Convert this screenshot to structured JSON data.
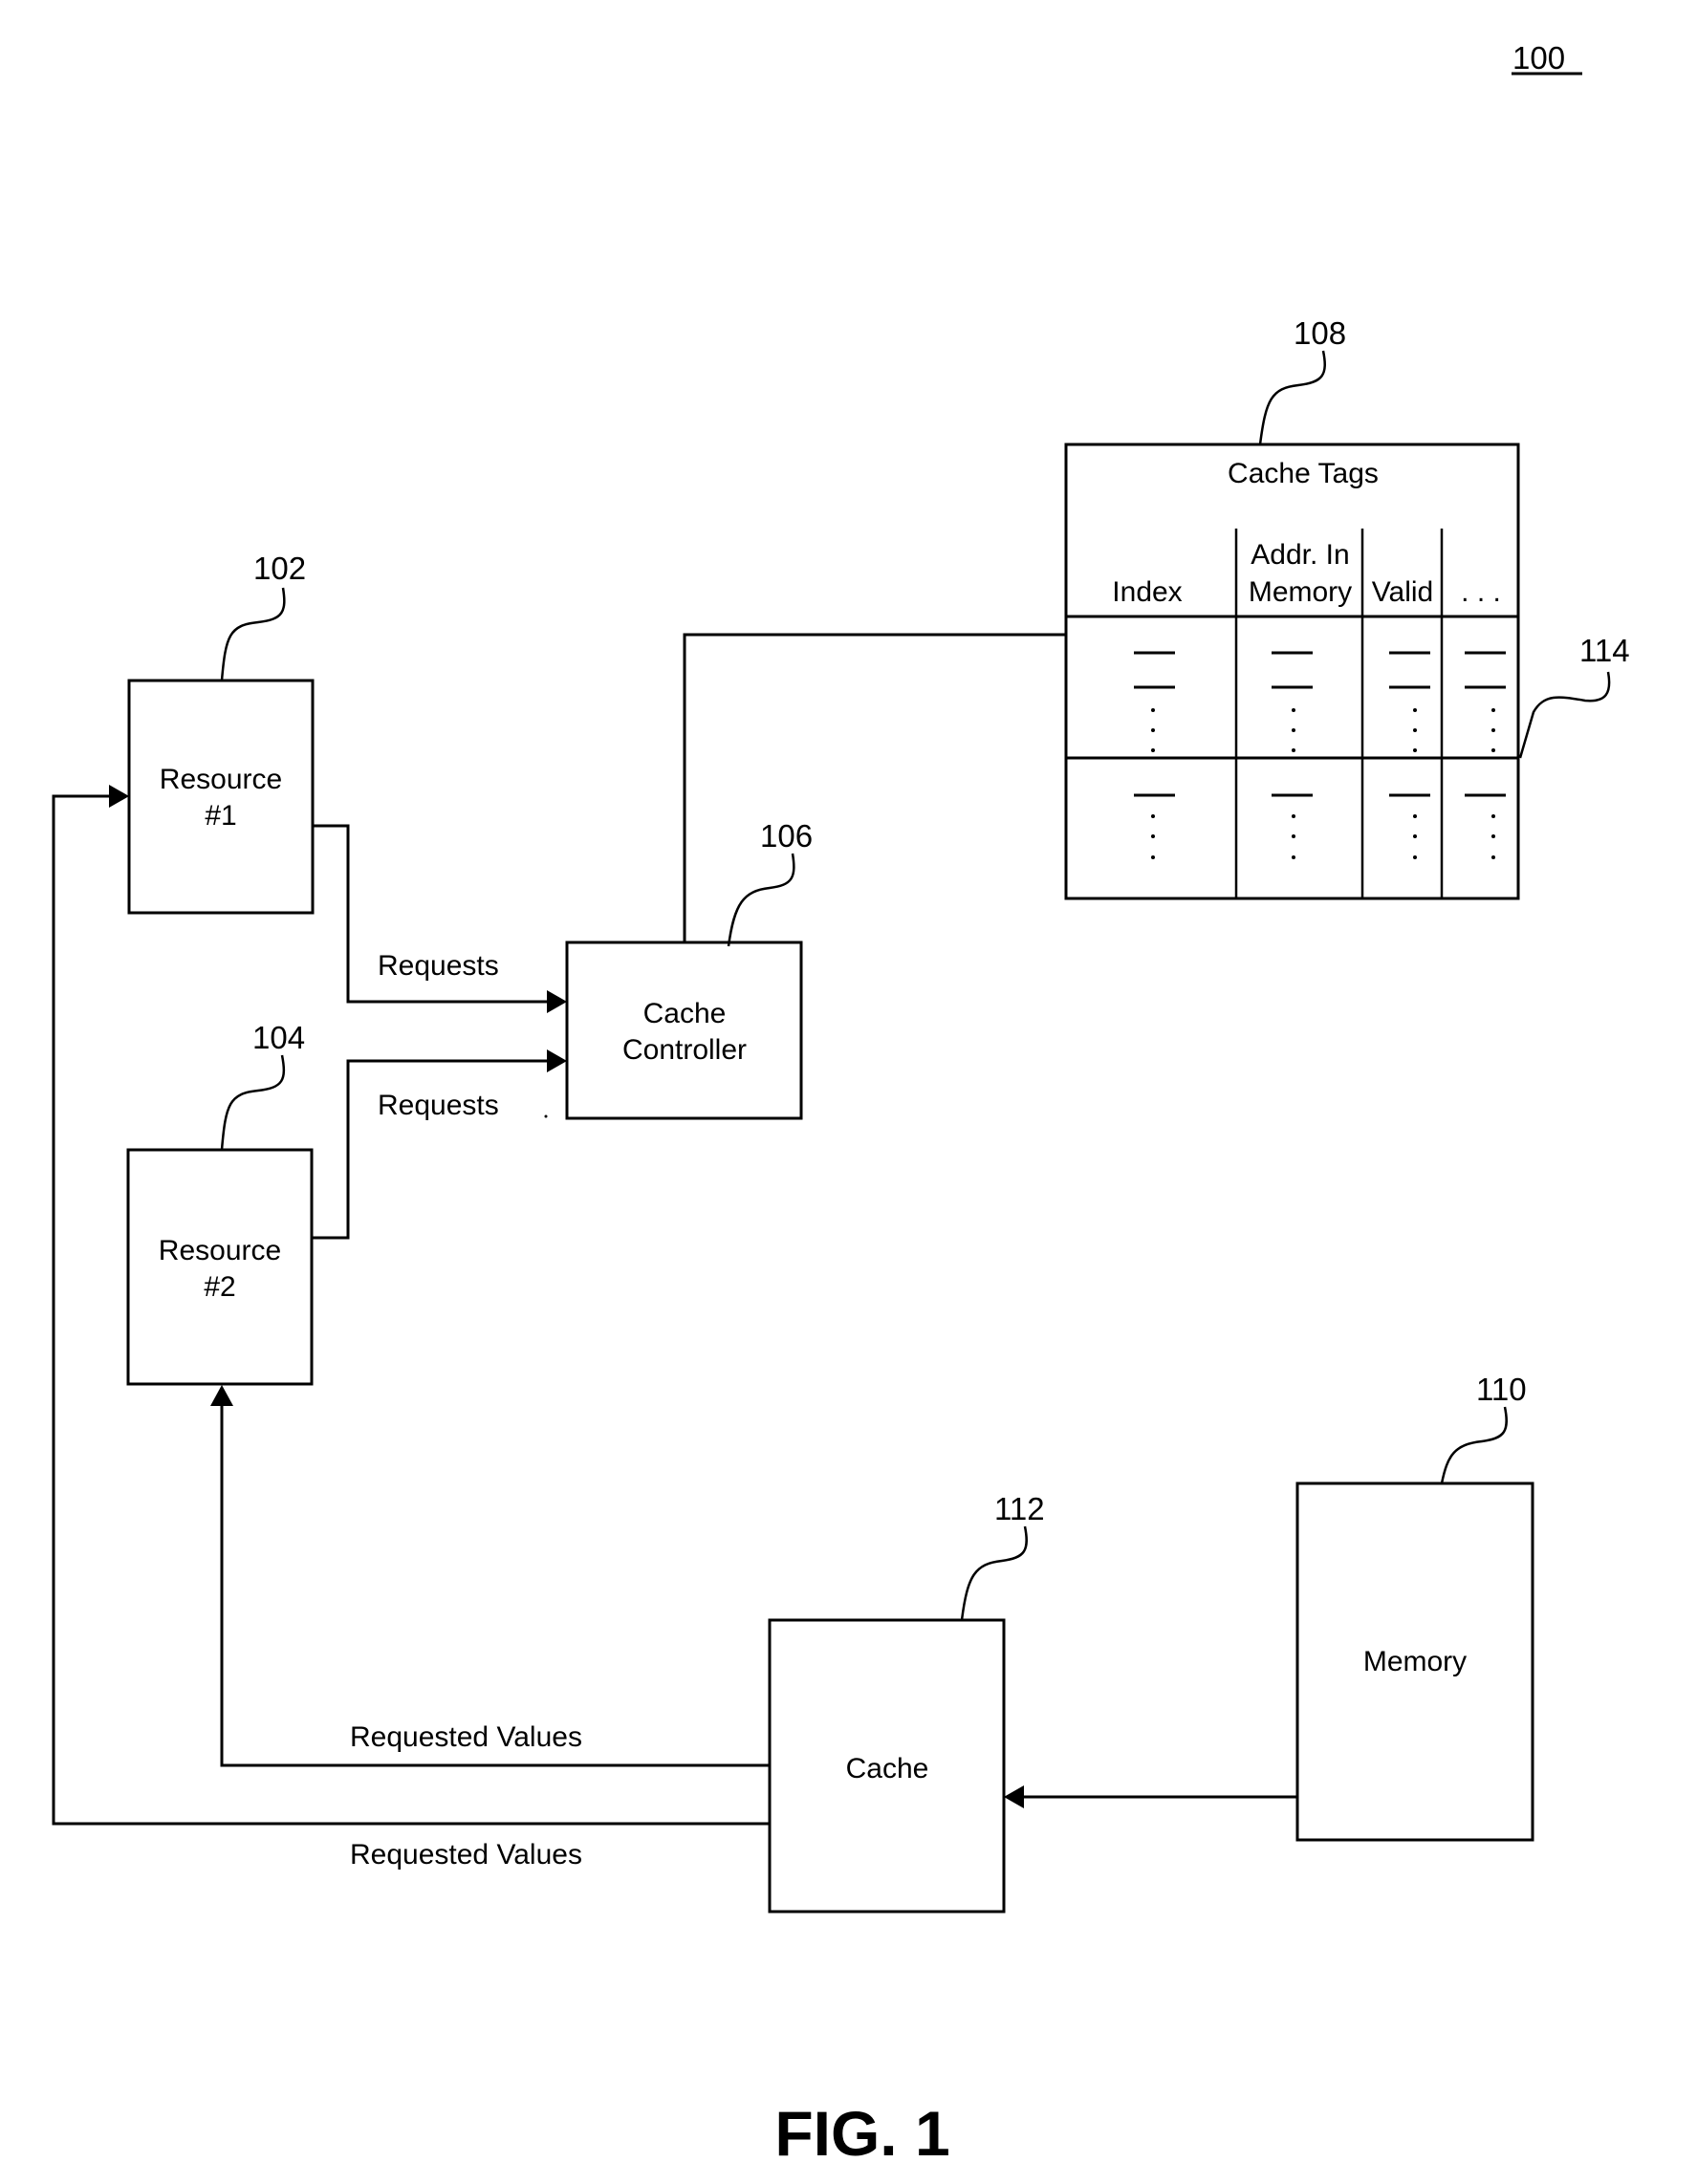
{
  "figure": {
    "reference": "100",
    "caption": "FIG. 1"
  },
  "components": {
    "resource1": {
      "ref": "102",
      "line1": "Resource",
      "line2": "#1"
    },
    "resource2": {
      "ref": "104",
      "line1": "Resource",
      "line2": "#2"
    },
    "cache_controller": {
      "ref": "106",
      "line1": "Cache",
      "line2": "Controller"
    },
    "cache_tags": {
      "ref": "108",
      "title": "Cache Tags",
      "columns": [
        {
          "line1": "",
          "line2": "Index"
        },
        {
          "line1": "Addr. In",
          "line2": "Memory"
        },
        {
          "line1": "",
          "line2": "Valid"
        },
        {
          "line1": "",
          "line2": ". . ."
        }
      ],
      "entry_ref": "114"
    },
    "memory": {
      "ref": "110",
      "label": "Memory"
    },
    "cache": {
      "ref": "112",
      "label": "Cache"
    }
  },
  "connections": {
    "requests_1": "Requests",
    "requests_2": "Requests",
    "values_1": "Requested Values",
    "values_2": "Requested Values"
  }
}
